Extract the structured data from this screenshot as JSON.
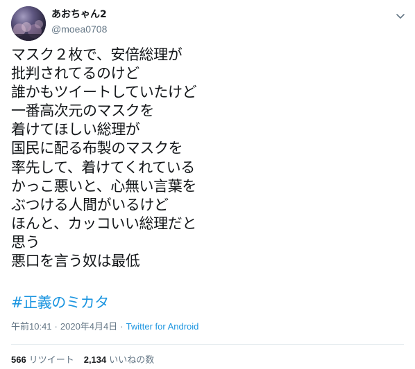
{
  "author": {
    "display_name": "あおちゃん2",
    "handle": "@moea0708",
    "avatar_icon": "avatar-photo-icon"
  },
  "menu": {
    "caret_icon": "chevron-down-icon"
  },
  "tweet": {
    "lines": [
      "マスク２枚で、安倍総理が",
      "批判されてるのけど",
      "誰かもツイートしていたけど",
      "一番高次元のマスクを",
      "着けてほしい総理が",
      "国民に配る布製のマスクを",
      "率先して、着けてくれている",
      "かっこ悪いと、心無い言葉を",
      "ぶつける人間がいるけど",
      "ほんと、カッコいい総理だと",
      "思う",
      "悪口を言う奴は最低"
    ],
    "hashtag": "#正義のミカタ"
  },
  "meta": {
    "time": "午前10:41",
    "separator": "·",
    "date": "2020年4月4日",
    "source": "Twitter for Android"
  },
  "stats": {
    "retweets_count": "566",
    "retweets_label": "リツイート",
    "likes_count": "2,134",
    "likes_label": "いいねの数"
  },
  "colors": {
    "text": "#14171a",
    "secondary": "#657786",
    "link": "#1b95e0",
    "divider": "#e6ecf0"
  }
}
